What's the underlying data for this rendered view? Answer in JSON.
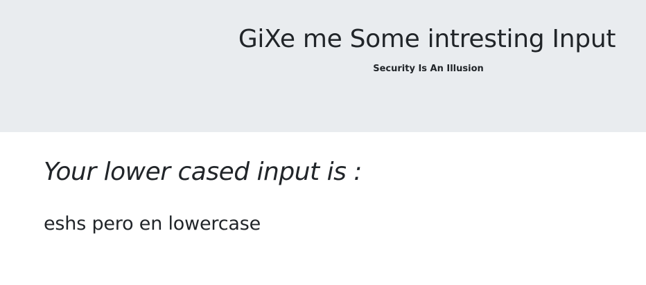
{
  "header": {
    "title": "GiXe me Some intresting Input",
    "subtitle": "Security Is An Illusion"
  },
  "result": {
    "heading": "Your lower cased input is :",
    "value": "eshs pero en lowercase"
  },
  "colors": {
    "header_background": "#e9ecef",
    "text": "#212529",
    "page_background": "#ffffff"
  }
}
